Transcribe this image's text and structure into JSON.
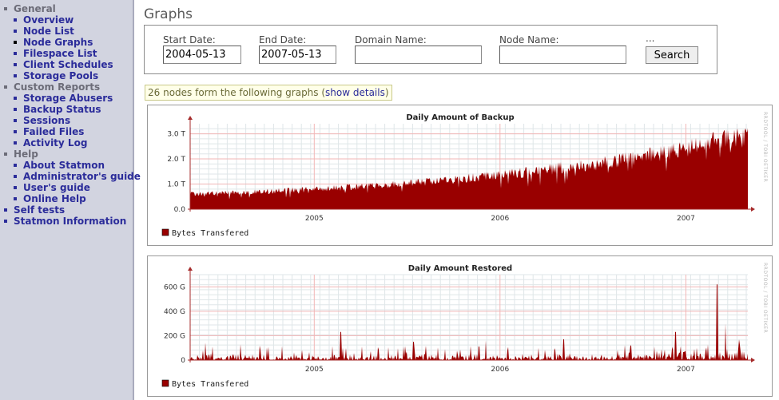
{
  "sidebar": {
    "sections": [
      {
        "label": "General",
        "items": [
          {
            "label": "Overview"
          },
          {
            "label": "Node List"
          },
          {
            "label": "Node Graphs",
            "current": true
          },
          {
            "label": "Filespace List"
          },
          {
            "label": "Client Schedules"
          },
          {
            "label": "Storage Pools"
          }
        ]
      },
      {
        "label": "Custom Reports",
        "items": [
          {
            "label": "Storage Abusers"
          },
          {
            "label": "Backup Status"
          },
          {
            "label": "Sessions"
          },
          {
            "label": "Failed Files"
          },
          {
            "label": "Activity Log"
          }
        ]
      },
      {
        "label": "Help",
        "items": [
          {
            "label": "About Statmon"
          },
          {
            "label": "Administrator's guide"
          },
          {
            "label": "User's guide"
          },
          {
            "label": "Online Help"
          }
        ]
      },
      {
        "label": "Self tests",
        "link": true,
        "items": []
      },
      {
        "label": "Statmon Information",
        "link": true,
        "items": []
      }
    ]
  },
  "page": {
    "title": "Graphs"
  },
  "search": {
    "start_label": "Start Date:",
    "start_value": "2004-05-13",
    "end_label": "End Date:",
    "end_value": "2007-05-13",
    "domain_label": "Domain Name:",
    "domain_value": "",
    "node_label": "Node Name:",
    "node_value": "",
    "extra_label": "...",
    "button": "Search"
  },
  "notice": {
    "text": "26 nodes form the following graphs (",
    "link": "show details",
    "close": ")"
  },
  "watermark": "RRDTOOL / TOBI OETIKER",
  "colors": {
    "area": "#990000",
    "grid_minor": "#dfe6e8",
    "grid_major": "#f1b6b6",
    "axis": "#a52a2a"
  },
  "chart_data": [
    {
      "type": "area",
      "title": "Daily Amount of Backup",
      "x_ticks": [
        "2005",
        "2006",
        "2007"
      ],
      "x_range": [
        "2004-05-13",
        "2007-05-13"
      ],
      "y_ticks": [
        "0.0",
        "1.0 T",
        "2.0 T",
        "3.0 T"
      ],
      "ylim": [
        0,
        3.4
      ],
      "unit": "T",
      "series": [
        {
          "name": "Bytes Transfered",
          "trend": [
            [
              0,
              0.6
            ],
            [
              0.12,
              0.68
            ],
            [
              0.25,
              0.82
            ],
            [
              0.38,
              1.0
            ],
            [
              0.5,
              1.22
            ],
            [
              0.62,
              1.5
            ],
            [
              0.75,
              1.85
            ],
            [
              0.87,
              2.3
            ],
            [
              0.96,
              2.75
            ],
            [
              1.0,
              2.85
            ]
          ]
        }
      ]
    },
    {
      "type": "area",
      "title": "Daily Amount Restored",
      "x_ticks": [
        "2005",
        "2006",
        "2007"
      ],
      "x_range": [
        "2004-05-13",
        "2007-05-13"
      ],
      "y_ticks": [
        "0",
        "200 G",
        "400 G",
        "600 G"
      ],
      "ylim": [
        0,
        700
      ],
      "unit": "G",
      "series": [
        {
          "name": "Bytes Transfered",
          "peaks": [
            [
              0.27,
              230
            ],
            [
              0.4,
              150
            ],
            [
              0.53,
              160
            ],
            [
              0.67,
              170
            ],
            [
              0.79,
              120
            ],
            [
              0.87,
              230
            ],
            [
              0.945,
              620
            ],
            [
              0.96,
              300
            ]
          ]
        }
      ]
    }
  ]
}
